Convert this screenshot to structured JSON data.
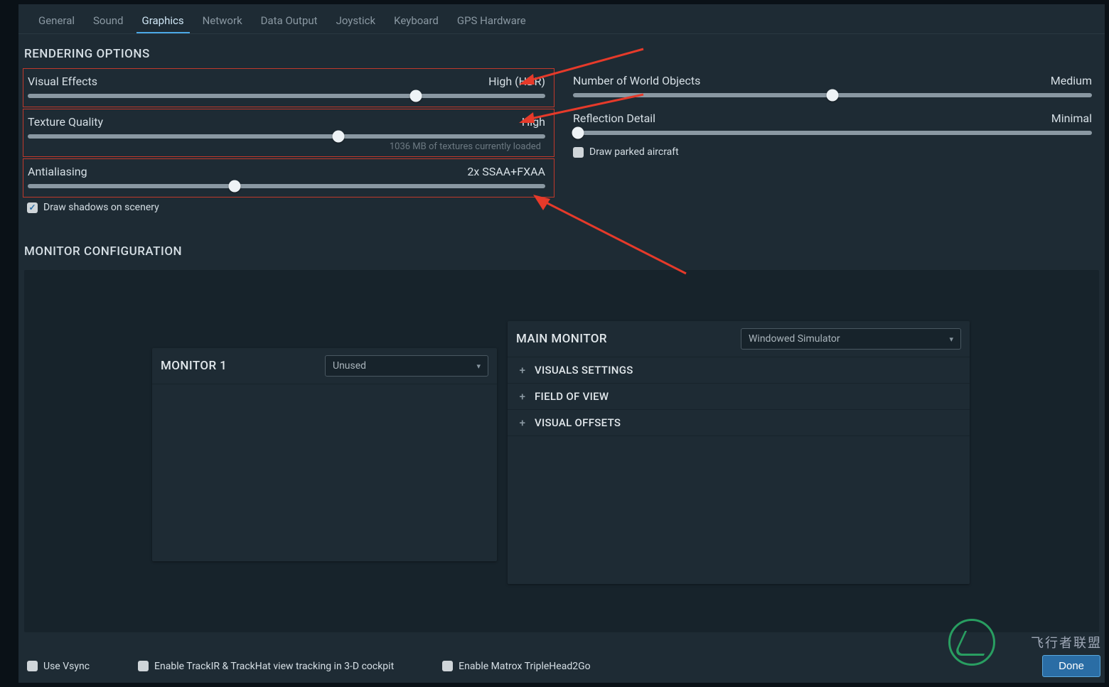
{
  "tabs": {
    "general": "General",
    "sound": "Sound",
    "graphics": "Graphics",
    "network": "Network",
    "data_output": "Data Output",
    "joystick": "Joystick",
    "keyboard": "Keyboard",
    "gps": "GPS Hardware"
  },
  "sections": {
    "rendering": "RENDERING OPTIONS",
    "monitor": "MONITOR CONFIGURATION"
  },
  "settings": {
    "visual_effects": {
      "label": "Visual Effects",
      "value": "High (HDR)",
      "pos": 75
    },
    "texture_quality": {
      "label": "Texture Quality",
      "value": "High",
      "pos": 60,
      "hint": "1036 MB of textures currently loaded"
    },
    "antialiasing": {
      "label": "Antialiasing",
      "value": "2x SSAA+FXAA",
      "pos": 40
    },
    "world_objects": {
      "label": "Number of World Objects",
      "value": "Medium",
      "pos": 50
    },
    "reflection": {
      "label": "Reflection Detail",
      "value": "Minimal",
      "pos": 1
    }
  },
  "checkboxes": {
    "shadows": "Draw shadows on scenery",
    "parked": "Draw parked aircraft",
    "vsync": "Use Vsync",
    "trackir": "Enable TrackIR & TrackHat view tracking in 3-D cockpit",
    "matrox": "Enable Matrox TripleHead2Go"
  },
  "monitors": {
    "m1_title": "MONITOR 1",
    "m1_mode": "Unused",
    "main_title": "MAIN MONITOR",
    "main_mode": "Windowed Simulator",
    "exp_visuals": "VISUALS SETTINGS",
    "exp_fov": "FIELD OF VIEW",
    "exp_offsets": "VISUAL OFFSETS"
  },
  "footer": {
    "done": "Done"
  },
  "watermark": "飞行者联盟"
}
